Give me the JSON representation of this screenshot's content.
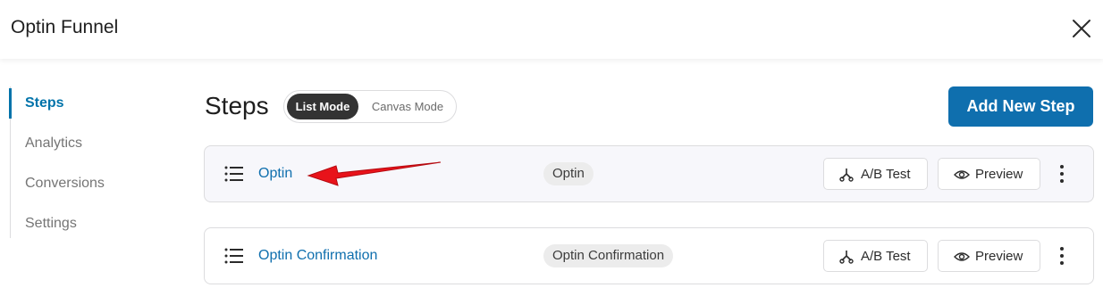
{
  "header": {
    "title": "Optin Funnel"
  },
  "sidebar": {
    "items": [
      {
        "label": "Steps",
        "active": true
      },
      {
        "label": "Analytics",
        "active": false
      },
      {
        "label": "Conversions",
        "active": false
      },
      {
        "label": "Settings",
        "active": false
      }
    ]
  },
  "main": {
    "title": "Steps",
    "mode_toggle": {
      "list_label": "List Mode",
      "canvas_label": "Canvas Mode",
      "selected": "List Mode"
    },
    "add_button_label": "Add New Step",
    "steps": [
      {
        "name": "Optin",
        "type_badge": "Optin",
        "ab_label": "A/B Test",
        "preview_label": "Preview"
      },
      {
        "name": "Optin Confirmation",
        "type_badge": "Optin Confirmation",
        "ab_label": "A/B Test",
        "preview_label": "Preview"
      }
    ]
  },
  "colors": {
    "accent": "#0f6fae",
    "active_nav": "#0073aa",
    "annotation_arrow": "#e8131a",
    "toggle_active_bg": "#333333"
  },
  "icons": [
    "close-icon",
    "drag-handle-icon",
    "ab-split-icon",
    "eye-icon",
    "more-vertical-icon"
  ]
}
